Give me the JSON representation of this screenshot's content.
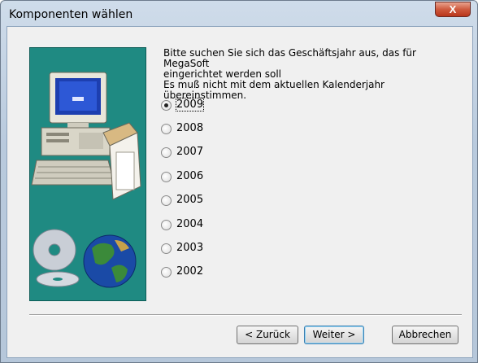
{
  "window": {
    "title": "Komponenten wählen",
    "close_label": "X"
  },
  "instructions": "Bitte suchen Sie sich das Geschäftsjahr aus, das für MegaSoft\neingerichtet werden soll\nEs muß nicht mit dem aktuellen Kalenderjahr übereinstimmen.",
  "years": [
    {
      "label": "2009",
      "selected": true
    },
    {
      "label": "2008",
      "selected": false
    },
    {
      "label": "2007",
      "selected": false
    },
    {
      "label": "2006",
      "selected": false
    },
    {
      "label": "2005",
      "selected": false
    },
    {
      "label": "2004",
      "selected": false
    },
    {
      "label": "2003",
      "selected": false
    },
    {
      "label": "2002",
      "selected": false
    }
  ],
  "buttons": {
    "back": "< Zurück",
    "next": "Weiter >",
    "cancel": "Abbrechen"
  },
  "colors": {
    "side_panel": "#1f8a82",
    "close_button": "#cf5a3e"
  },
  "icons": {
    "side_image": "computer-with-cds-and-globe"
  }
}
